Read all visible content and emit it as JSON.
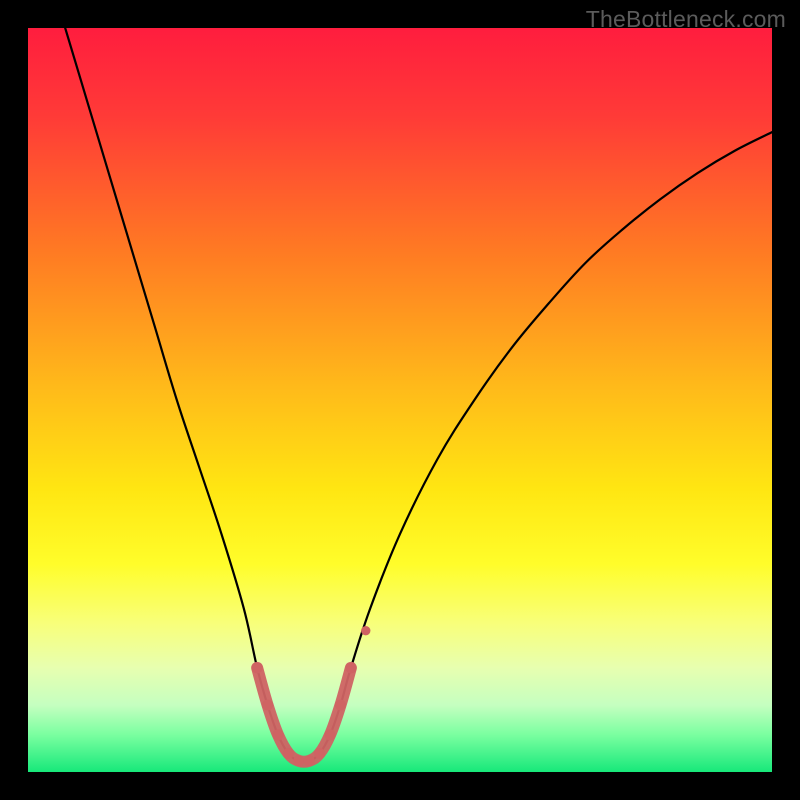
{
  "watermark": "TheBottleneck.com",
  "chart_data": {
    "type": "line",
    "title": "",
    "xlabel": "",
    "ylabel": "",
    "xlim": [
      0,
      100
    ],
    "ylim": [
      0,
      100
    ],
    "background_gradient": {
      "stops": [
        {
          "offset": 0.0,
          "color": "#ff1d3e"
        },
        {
          "offset": 0.12,
          "color": "#ff3b37"
        },
        {
          "offset": 0.3,
          "color": "#ff7a23"
        },
        {
          "offset": 0.48,
          "color": "#ffb91a"
        },
        {
          "offset": 0.62,
          "color": "#ffe612"
        },
        {
          "offset": 0.72,
          "color": "#fffd2a"
        },
        {
          "offset": 0.8,
          "color": "#f8ff7a"
        },
        {
          "offset": 0.86,
          "color": "#e7ffb0"
        },
        {
          "offset": 0.91,
          "color": "#c5ffc0"
        },
        {
          "offset": 0.95,
          "color": "#7affa0"
        },
        {
          "offset": 1.0,
          "color": "#17e87a"
        }
      ]
    },
    "series": [
      {
        "name": "bottleneck-curve",
        "stroke": "#000000",
        "stroke_width": 2.2,
        "x": [
          5,
          8,
          11,
          14,
          17,
          20,
          23,
          26,
          29,
          30.8,
          32.2,
          33.6,
          35.0,
          36.4,
          37.8,
          39.2,
          40.6,
          42.0,
          43.4,
          46,
          50,
          55,
          60,
          65,
          70,
          75,
          80,
          85,
          90,
          95,
          100
        ],
        "y": [
          100,
          90,
          80,
          70,
          60,
          50,
          41,
          32,
          22,
          14,
          9,
          5,
          2.5,
          1.5,
          1.5,
          2.5,
          5,
          9,
          14,
          22,
          32,
          42,
          50,
          57,
          63,
          68.5,
          73,
          77,
          80.5,
          83.5,
          86
        ]
      }
    ],
    "highlight": {
      "stroke": "#cf6363",
      "stroke_width": 12,
      "dots_radius": 5.5,
      "x": [
        30.8,
        32.2,
        33.6,
        35.0,
        36.4,
        37.8,
        39.2,
        40.6,
        42.0,
        43.4
      ],
      "y": [
        14,
        9,
        5,
        2.5,
        1.5,
        1.5,
        2.5,
        5,
        9,
        14
      ],
      "extra_dot": {
        "x": 45.4,
        "y": 19
      }
    }
  }
}
